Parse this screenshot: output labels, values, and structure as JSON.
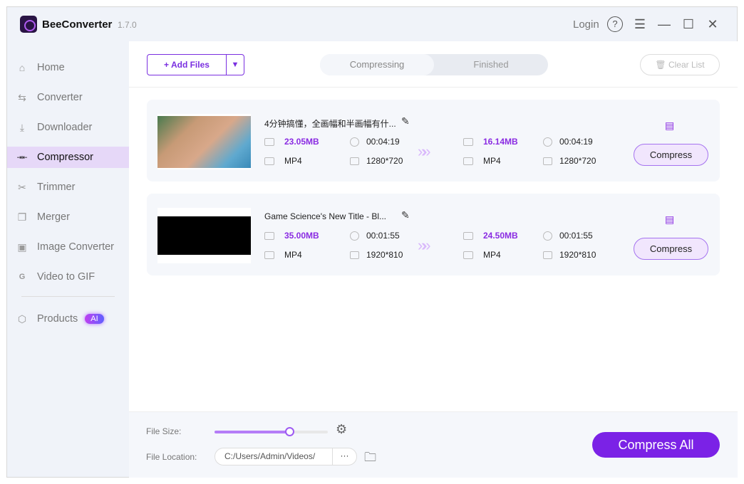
{
  "app": {
    "name": "BeeConverter",
    "version": "1.7.0",
    "login": "Login"
  },
  "sidebar": {
    "items": [
      {
        "label": "Home",
        "icon": "home-icon",
        "glyph": "⌂"
      },
      {
        "label": "Converter",
        "icon": "swap-icon",
        "glyph": "⇆"
      },
      {
        "label": "Downloader",
        "icon": "download-icon",
        "glyph": "⤓"
      },
      {
        "label": "Compressor",
        "icon": "compress-icon",
        "glyph": "⇥⇤"
      },
      {
        "label": "Trimmer",
        "icon": "scissors-icon",
        "glyph": "✂"
      },
      {
        "label": "Merger",
        "icon": "merge-icon",
        "glyph": "❐"
      },
      {
        "label": "Image Converter",
        "icon": "image-icon",
        "glyph": "▣"
      },
      {
        "label": "Video to GIF",
        "icon": "gif-icon",
        "glyph": "G"
      }
    ],
    "products": "Products",
    "ai_badge": "AI"
  },
  "toolbar": {
    "add_files": "+ Add Files",
    "tabs": [
      "Compressing",
      "Finished"
    ],
    "clear": "Clear List"
  },
  "files": [
    {
      "title": "4分钟搞懂，全画幅和半画幅有什...",
      "in_size": "23.05MB",
      "in_duration": "00:04:19",
      "in_format": "MP4",
      "in_res": "1280*720",
      "out_size": "16.14MB",
      "out_duration": "00:04:19",
      "out_format": "MP4",
      "out_res": "1280*720",
      "button": "Compress"
    },
    {
      "title": "Game Science's New Title - Bl...",
      "in_size": "35.00MB",
      "in_duration": "00:01:55",
      "in_format": "MP4",
      "in_res": "1920*810",
      "out_size": "24.50MB",
      "out_duration": "00:01:55",
      "out_format": "MP4",
      "out_res": "1920*810",
      "button": "Compress"
    }
  ],
  "footer": {
    "file_size_label": "File Size:",
    "file_size_level": 0.66,
    "file_location_label": "File Location:",
    "file_location": "C:/Users/Admin/Videos/",
    "more": "···",
    "compress_all": "Compress All"
  }
}
